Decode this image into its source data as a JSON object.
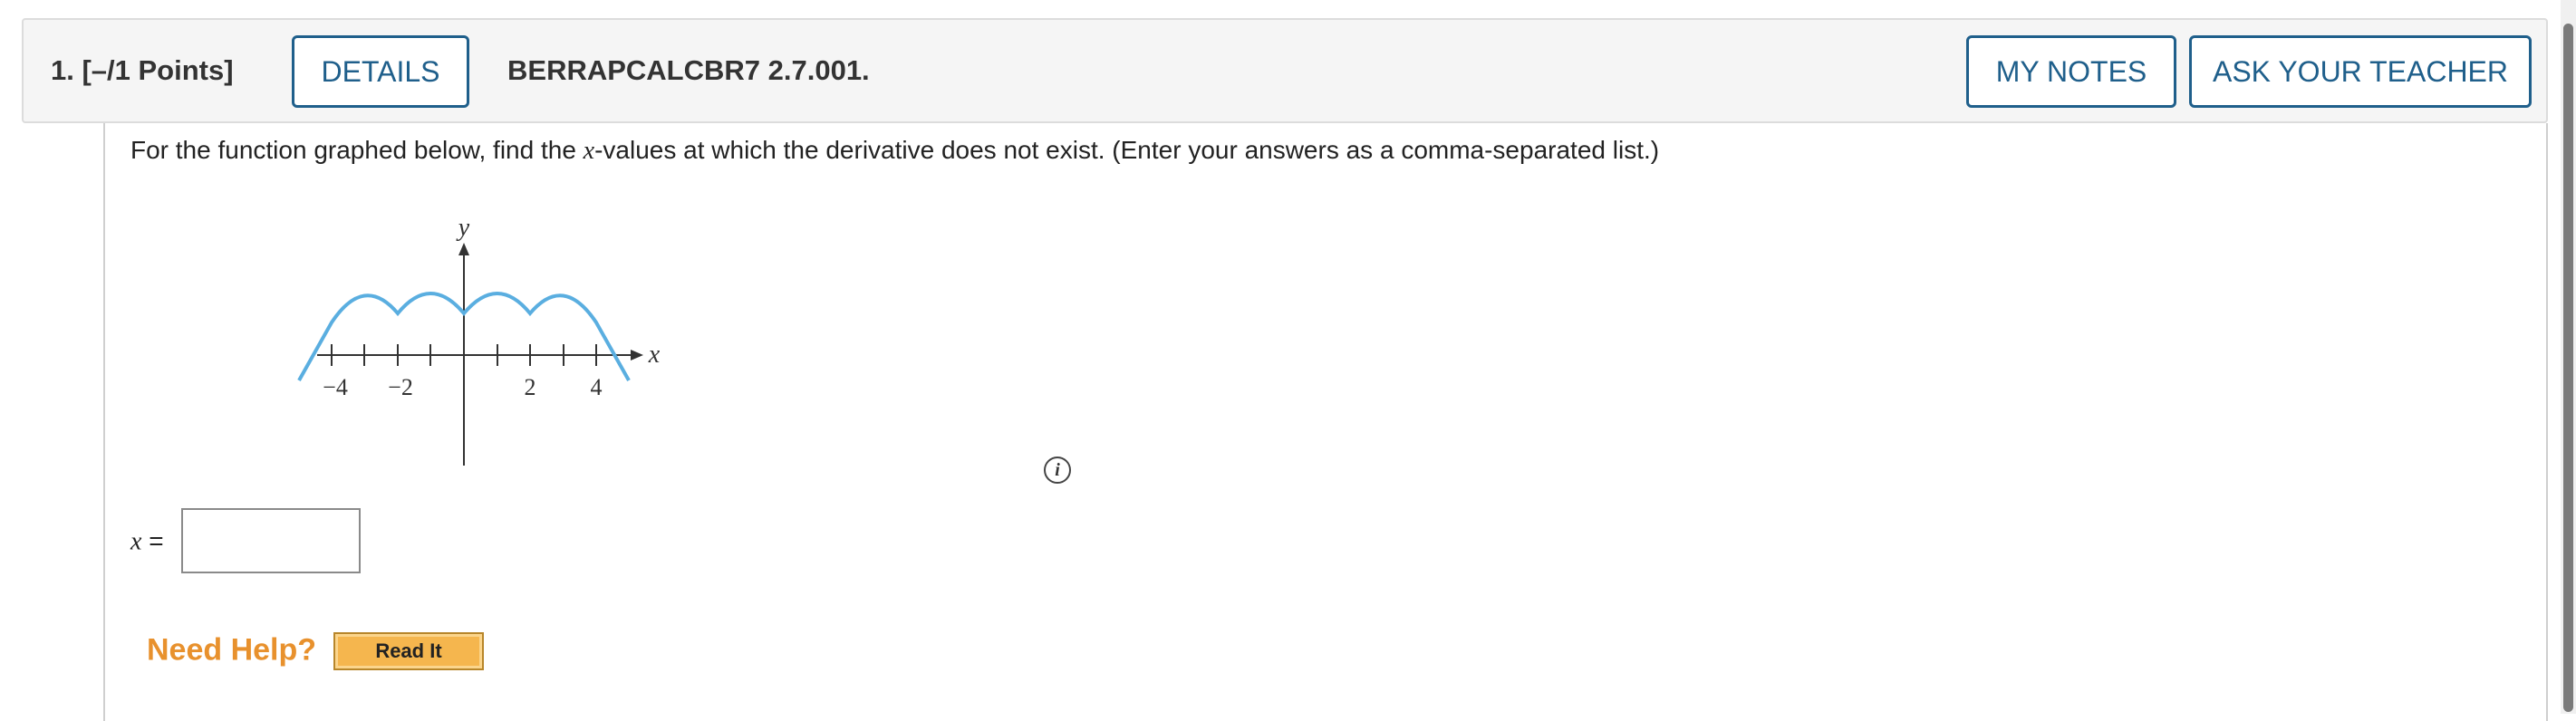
{
  "question": {
    "number_label": "1.  [–/1 Points]",
    "details_label": "DETAILS",
    "id_label": "BERRAPCALCBR7 2.7.001.",
    "my_notes_label": "MY NOTES",
    "ask_teacher_label": "ASK YOUR TEACHER"
  },
  "prompt": {
    "before": "For the function graphed below, find the ",
    "var": "x",
    "after": "-values at which the derivative does not exist. (Enter your answers as a comma-separated list.)"
  },
  "graph": {
    "y_axis_label": "y",
    "x_axis_label": "x",
    "tick_labels": [
      "−4",
      "−2",
      "2",
      "4"
    ],
    "curve_color": "#5aaee0"
  },
  "info_icon": {
    "glyph": "i"
  },
  "answer": {
    "var": "x",
    "equals": " =",
    "value": "",
    "placeholder": ""
  },
  "help": {
    "need_help_label": "Need Help?",
    "read_it_label": "Read It"
  },
  "colors": {
    "button_blue": "#1f5f8b",
    "need_help_orange": "#e8912d",
    "read_it_fill": "#f5b64e"
  }
}
